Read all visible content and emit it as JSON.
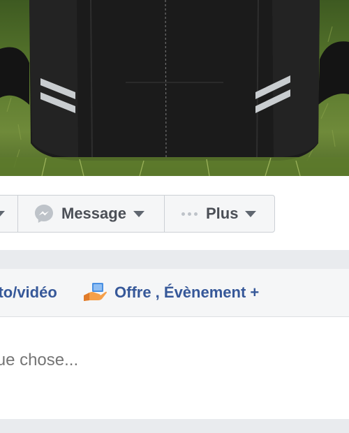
{
  "cover": {
    "icon": "backpack-photo"
  },
  "actions": {
    "first_caret_icon": "caret-down-icon",
    "message_label": "Message",
    "message_icon": "messenger-icon",
    "plus_label": "Plus",
    "plus_icon": "more-dots-icon"
  },
  "composer": {
    "tab_photo_label": "oto/vidéo",
    "offer_icon": "offer-hand-icon",
    "tab_more_label": "Offre , Évènement +",
    "placeholder": "quelque chose..."
  },
  "colors": {
    "link_blue": "#365899",
    "button_text": "#4b4f56",
    "placeholder": "#90949c",
    "page_bg": "#e9ebee"
  }
}
